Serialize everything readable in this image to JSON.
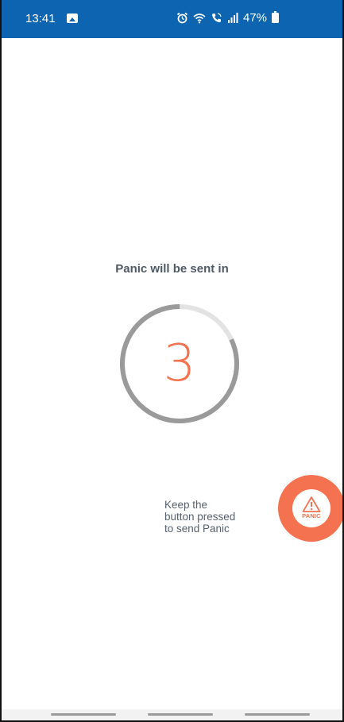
{
  "status_bar": {
    "time": "13:41",
    "battery": "47%",
    "icons": [
      "gallery-icon",
      "alarm-icon",
      "wifi-icon",
      "wifi-call-icon",
      "signal-icon",
      "battery-icon"
    ],
    "background_color": "#0d64b0"
  },
  "panic": {
    "title": "Panic will be sent in",
    "countdown_value": "3",
    "countdown_progress": 0.18,
    "hint_lines": [
      "Keep the",
      "button pressed",
      "to send Panic"
    ],
    "button_label": "PANIC",
    "accent_color": "#f4724f"
  },
  "nav_bar": {
    "handles": 3
  }
}
